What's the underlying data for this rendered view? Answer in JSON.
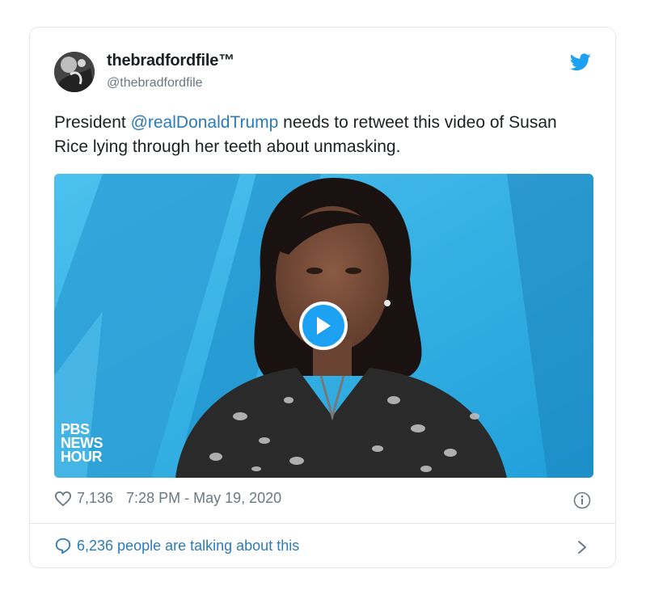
{
  "tweet": {
    "display_name": "thebradfordfile™",
    "handle": "@thebradfordfile",
    "text_before": "President ",
    "mention": "@realDonaldTrump",
    "text_after": " needs to retweet this video of Susan Rice lying through her teeth about unmasking.",
    "likes": "7,136",
    "timestamp": "7:28 PM - May 19, 2020",
    "talking": "6,236 people are talking about this"
  },
  "media": {
    "logo_line1": "PBS",
    "logo_line2": "NEWS",
    "logo_line3": "HOUR"
  },
  "icons": {
    "bird": "twitter-bird-icon",
    "play": "play-icon",
    "heart": "heart-icon",
    "info": "info-icon",
    "bubble": "speech-bubble-icon",
    "chevron": "chevron-right-icon"
  },
  "colors": {
    "accent": "#1da1f2",
    "link": "#2b7bb9",
    "muted": "#697882",
    "border": "#e1e8ed"
  }
}
